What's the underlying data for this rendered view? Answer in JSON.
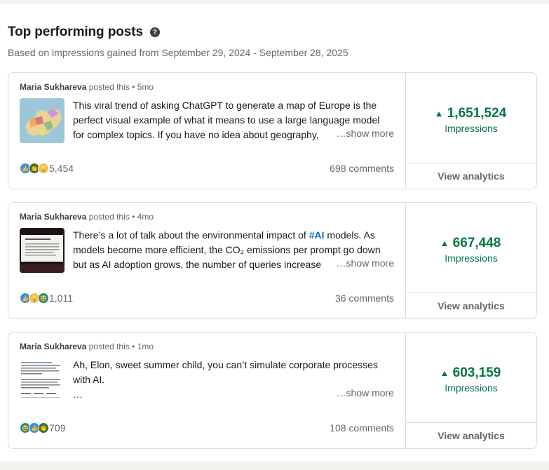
{
  "header": {
    "title": "Top performing posts",
    "subtitle": "Based on impressions gained from September 29, 2024 - September 28, 2025"
  },
  "posts": [
    {
      "author": "Maria Sukhareva",
      "posted": "posted this",
      "age": "5mo",
      "lines": [
        "This viral trend of asking ChatGPT to generate a map of Europe is the",
        "perfect visual example of what it means to use a large language model",
        "for complex topics. If you have no idea about geography,"
      ],
      "show_more": "…show more",
      "reactions": "5,454",
      "comments": "698 comments",
      "impressions": "1,651,524",
      "impressions_label": "Impressions",
      "view_analytics": "View analytics",
      "thumb_icon": "europe-map-icon"
    },
    {
      "author": "Maria Sukhareva",
      "posted": "posted this",
      "age": "4mo",
      "line1_pre": "There’s a lot of talk about the environmental impact of ",
      "line1_tag": "#AI",
      "line1_post": " models. As",
      "lines": [
        "models become more efficient, the CO₂ emissions per prompt go down",
        "but as AI adoption grows, the number of queries increase"
      ],
      "show_more": "…show more",
      "reactions": "1,011",
      "comments": "36 comments",
      "impressions": "667,448",
      "impressions_label": "Impressions",
      "view_analytics": "View analytics",
      "thumb_icon": "presentation-slide-icon"
    },
    {
      "author": "Maria Sukhareva",
      "posted": "posted this",
      "age": "1mo",
      "lines": [
        "Ah, Elon, sweet summer child, you can’t simulate corporate processes",
        "with AI.",
        "…"
      ],
      "show_more": "…show more",
      "reactions": "709",
      "comments": "108 comments",
      "impressions": "603,159",
      "impressions_label": "Impressions",
      "view_analytics": "View analytics",
      "thumb_icon": "text-post-icon"
    }
  ],
  "colors": {
    "accent_green": "#057642",
    "hashtag_blue": "#0a66c2"
  }
}
